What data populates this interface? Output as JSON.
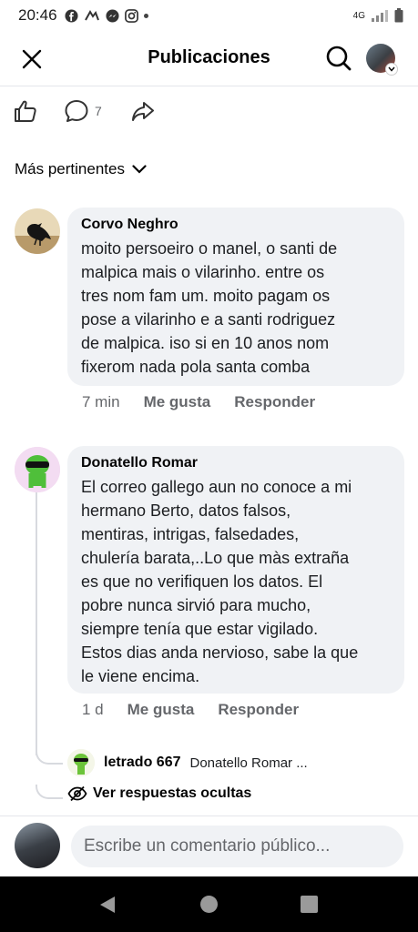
{
  "status_bar": {
    "time": "20:46",
    "network": "4G"
  },
  "header": {
    "title": "Publicaciones"
  },
  "actions": {
    "comment_count": "7"
  },
  "sort": {
    "label": "Más pertinentes"
  },
  "comments": [
    {
      "author": "Corvo Neghro",
      "text": "moito persoeiro o manel, o santi de\nmalpica mais o vilarinho. entre os\ntres nom fam um. moito pagam os\npose a vilarinho e a santi rodriguez\nde malpica. iso si en 10 anos nom\nfixerom nada pola santa comba",
      "time": "7 min",
      "like_label": "Me gusta",
      "reply_label": "Responder"
    },
    {
      "author": "Donatello Romar",
      "text": "El correo gallego aun no conoce a mi\nhermano Berto, datos falsos,\nmentiras, intrigas, falsedades,\nchulería barata,..Lo que màs extraña\nes que no verifiquen los datos. El\npobre nunca sirvió para mucho,\nsiempre tenía que estar vigilado.\nEstos dias anda nervioso, sabe la que\nle viene encima.",
      "time": "1 d",
      "like_label": "Me gusta",
      "reply_label": "Responder"
    }
  ],
  "reply_preview": {
    "author": "letrado 667",
    "snippet": "Donatello Romar ..."
  },
  "hidden_replies": {
    "label": "Ver respuestas ocultas"
  },
  "composer": {
    "placeholder": "Escribe un comentario público..."
  },
  "colors": {
    "bubble": "#f0f2f5",
    "meta_text": "#65676b",
    "divider": "#e4e6eb"
  }
}
